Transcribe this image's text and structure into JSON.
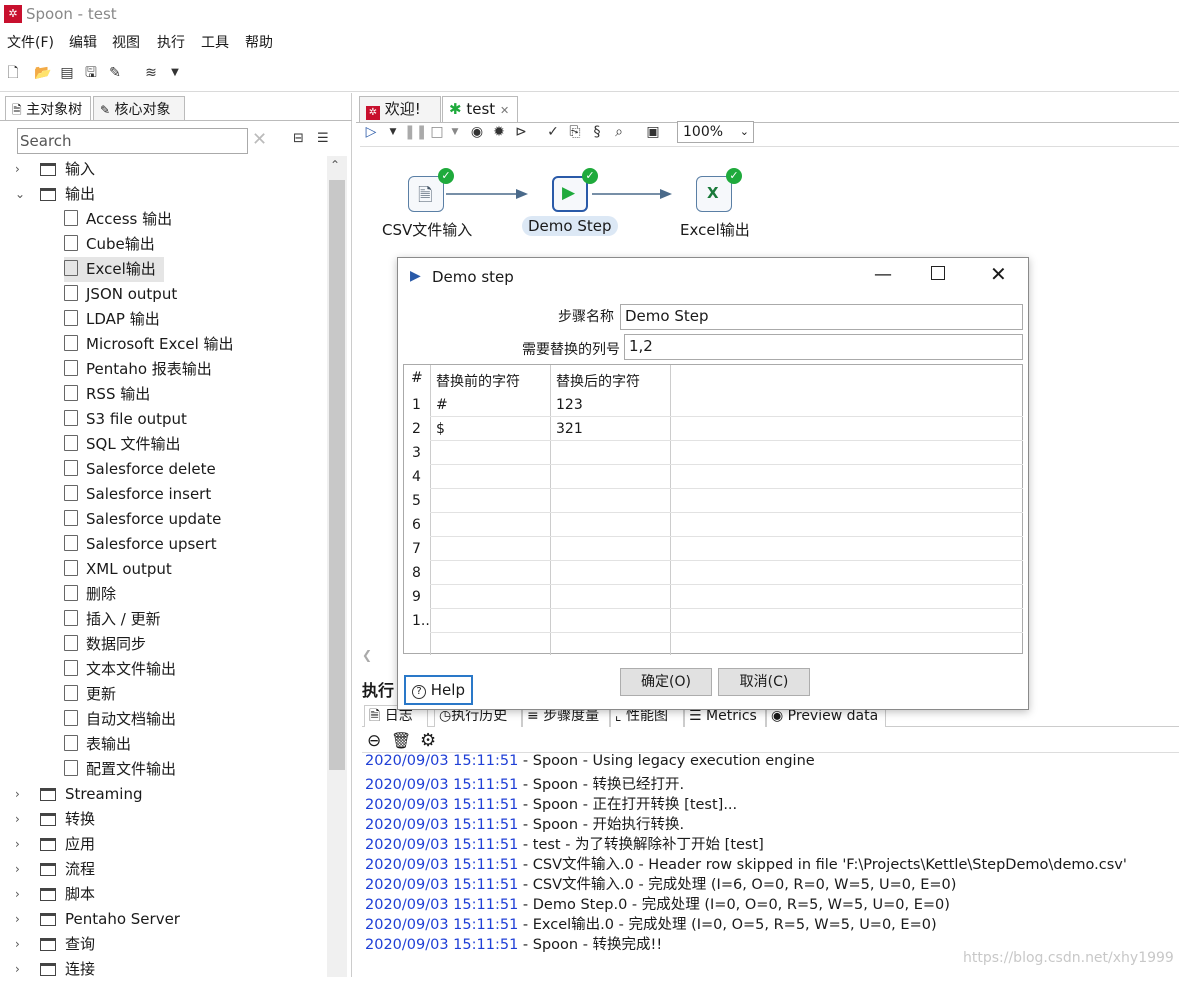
{
  "window": {
    "title": "Spoon - test"
  },
  "menu": [
    "文件(F)",
    "编辑",
    "视图",
    "执行",
    "工具",
    "帮助"
  ],
  "left_tabs": [
    "主对象树",
    "核心对象"
  ],
  "search": {
    "placeholder": "Search",
    "value": "Search"
  },
  "tree": {
    "folders_top": [
      {
        "label": "输入",
        "expanded": false
      },
      {
        "label": "输出",
        "expanded": true
      }
    ],
    "output_items": [
      "Access 输出",
      "Cube输出",
      "Excel输出",
      "JSON output",
      "LDAP 输出",
      "Microsoft Excel 输出",
      "Pentaho 报表输出",
      "RSS 输出",
      "S3 file output",
      "SQL 文件输出",
      "Salesforce delete",
      "Salesforce insert",
      "Salesforce update",
      "Salesforce upsert",
      "XML output",
      "删除",
      "插入 / 更新",
      "数据同步",
      "文本文件输出",
      "更新",
      "自动文档输出",
      "表输出",
      "配置文件输出"
    ],
    "selected_item": "Excel输出",
    "folders_bottom": [
      "Streaming",
      "转换",
      "应用",
      "流程",
      "脚本",
      "Pentaho Server",
      "查询",
      "连接"
    ]
  },
  "right_tabs": [
    {
      "label": "欢迎!"
    },
    {
      "label": "test"
    }
  ],
  "zoom": "100%",
  "steps": [
    {
      "label": "CSV文件输入"
    },
    {
      "label": "Demo Step"
    },
    {
      "label": "Excel输出"
    }
  ],
  "dialog": {
    "title": "Demo step",
    "step_name_label": "步骤名称",
    "step_name_value": "Demo Step",
    "columns_label": "需要替换的列号",
    "columns_value": "1,2",
    "grid_headers": [
      "#",
      "替换前的字符",
      "替换后的字符"
    ],
    "grid_rows": [
      {
        "n": "1",
        "before": "#",
        "after": "123"
      },
      {
        "n": "2",
        "before": "$",
        "after": "321"
      },
      {
        "n": "3",
        "before": "",
        "after": ""
      },
      {
        "n": "4",
        "before": "",
        "after": ""
      },
      {
        "n": "5",
        "before": "",
        "after": ""
      },
      {
        "n": "6",
        "before": "",
        "after": ""
      },
      {
        "n": "7",
        "before": "",
        "after": ""
      },
      {
        "n": "8",
        "before": "",
        "after": ""
      },
      {
        "n": "9",
        "before": "",
        "after": ""
      },
      {
        "n": "1..",
        "before": "",
        "after": ""
      }
    ],
    "ok_label": "确定(O)",
    "cancel_label": "取消(C)",
    "help_label": "Help"
  },
  "exec_title": "执行",
  "bottom_tabs": [
    "日志",
    "执行历史",
    "步骤度量",
    "性能图",
    "Metrics",
    "Preview data"
  ],
  "log": [
    {
      "ts": "2020/09/03 15:11:51",
      "msg": " - Spoon - Using legacy execution engine"
    },
    {
      "ts": "2020/09/03 15:11:51",
      "msg": " - Spoon - 转换已经打开."
    },
    {
      "ts": "2020/09/03 15:11:51",
      "msg": " - Spoon - 正在打开转换 [test]..."
    },
    {
      "ts": "2020/09/03 15:11:51",
      "msg": " - Spoon - 开始执行转换."
    },
    {
      "ts": "2020/09/03 15:11:51",
      "msg": " - test - 为了转换解除补丁开始  [test]"
    },
    {
      "ts": "2020/09/03 15:11:51",
      "msg": " - CSV文件输入.0 - Header row skipped in file 'F:\\Projects\\Kettle\\StepDemo\\demo.csv'"
    },
    {
      "ts": "2020/09/03 15:11:51",
      "msg": " - CSV文件输入.0 - 完成处理 (I=6, O=0, R=0, W=5, U=0, E=0)"
    },
    {
      "ts": "2020/09/03 15:11:51",
      "msg": " - Demo Step.0 - 完成处理 (I=0, O=0, R=5, W=5, U=0, E=0)"
    },
    {
      "ts": "2020/09/03 15:11:51",
      "msg": " - Excel输出.0 - 完成处理 (I=0, O=5, R=5, W=5, U=0, E=0)"
    },
    {
      "ts": "2020/09/03 15:11:51",
      "msg": " - Spoon - 转换完成!!"
    }
  ],
  "watermark": "https://blog.csdn.net/xhy1999",
  "colors": {
    "accent": "#1f3fd6",
    "success": "#1faa3c",
    "brand": "#c8102e",
    "focus": "#2a78c8"
  }
}
